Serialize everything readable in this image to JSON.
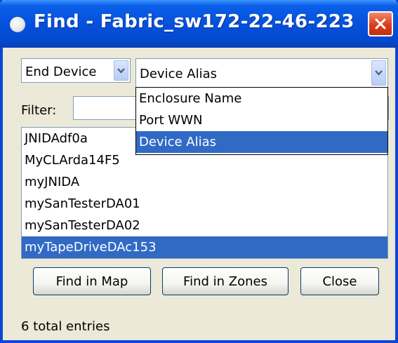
{
  "window": {
    "title": "Find - Fabric_sw172-22-46-223"
  },
  "type_combo": {
    "value": "End Device"
  },
  "attribute_combo": {
    "value": "Device Alias",
    "options": [
      "Enclosure Name",
      "Port WWN",
      "Device Alias"
    ],
    "selected": "Device Alias"
  },
  "filter": {
    "label": "Filter:",
    "value": ""
  },
  "results": {
    "items": [
      "JNIDAdf0a",
      "MyCLArda14F5",
      "myJNIDA",
      "mySanTesterDA01",
      "mySanTesterDA02",
      "myTapeDriveDAc153"
    ],
    "selected": "myTapeDriveDAc153"
  },
  "buttons": {
    "find_in_map": "Find in Map",
    "find_in_zones": "Find in Zones",
    "close": "Close"
  },
  "status": "6 total entries",
  "colors": {
    "titlebar": "#0551dd",
    "selection": "#316ac5",
    "close": "#d83e1c",
    "dialog": "#ece9d8"
  }
}
